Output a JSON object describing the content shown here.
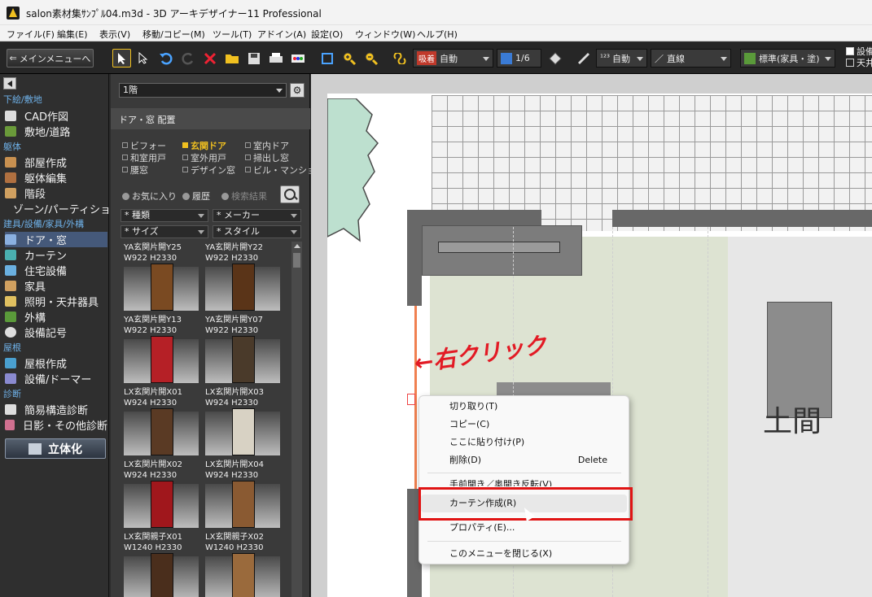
{
  "window": {
    "title": "salon素材集ｻﾝﾌﾟﾙ04.m3d - 3D アーキデザイナー11 Professional"
  },
  "menu": [
    "ファイル(F)",
    "編集(E)",
    "表示(V)",
    "移動/コピー(M)",
    "ツール(T)",
    "アドイン(A)",
    "設定(O)",
    "ウィンドウ(W)",
    "ヘルプ(H)"
  ],
  "toolbar": {
    "main_menu_label": "メインメニューへ",
    "snap_tag": "吸着",
    "snap_mode": "自動",
    "grid_ratio": "1/6",
    "dim_mode": "自動",
    "line_mode": "直線",
    "preset": "標準(家具・塗)",
    "check_1": "設備",
    "check_2": "天井"
  },
  "sidebar": {
    "categories": [
      {
        "label": "下絵/敷地",
        "items": [
          {
            "label": "CAD作図"
          },
          {
            "label": "敷地/道路"
          }
        ]
      },
      {
        "label": "躯体",
        "items": [
          {
            "label": "部屋作成"
          },
          {
            "label": "躯体編集"
          },
          {
            "label": "階段"
          },
          {
            "label": "ゾーン/パーティション"
          }
        ]
      },
      {
        "label": "建具/設備/家具/外構",
        "items": [
          {
            "label": "ドア・窓",
            "active": true
          },
          {
            "label": "カーテン"
          },
          {
            "label": "住宅設備"
          },
          {
            "label": "家具"
          },
          {
            "label": "照明・天井器具"
          },
          {
            "label": "外構"
          },
          {
            "label": "設備記号"
          }
        ]
      },
      {
        "label": "屋根",
        "items": [
          {
            "label": "屋根作成"
          },
          {
            "label": "設備/ドーマー"
          }
        ]
      },
      {
        "label": "診断",
        "items": [
          {
            "label": "簡易構造診断"
          },
          {
            "label": "日影・その他診断"
          }
        ]
      }
    ],
    "render_button": "立体化"
  },
  "panel": {
    "floor": "1階",
    "title": "ドア・窓 配置",
    "categories": [
      "ビフォー",
      "玄関ドア",
      "室内ドア",
      "和室用戸",
      "室外用戸",
      "掃出し窓",
      "腰窓",
      "デザイン窓",
      "ビル・マンション"
    ],
    "selected_category": "玄関ドア",
    "tabs": [
      "お気に入り",
      "履歴",
      "検索結果"
    ],
    "filters": [
      "* 種類",
      "* メーカー",
      "* サイズ",
      "* スタイル"
    ],
    "products": [
      {
        "name": "YA玄関片開Y25",
        "size": "W922 H2330",
        "color": "#7a4a22"
      },
      {
        "name": "YA玄関片開Y22",
        "size": "W922 H2330",
        "color": "#5a3418"
      },
      {
        "name": "YA玄関片開Y13",
        "size": "W922 H2330",
        "color": "#b52026"
      },
      {
        "name": "YA玄関片開Y07",
        "size": "W922 H2330",
        "color": "#4a3a2a"
      },
      {
        "name": "LX玄関片開X01",
        "size": "W924 H2330",
        "color": "#5a3a24"
      },
      {
        "name": "LX玄関片開X03",
        "size": "W924 H2330",
        "color": "#d8d2c4"
      },
      {
        "name": "LX玄関片開X02",
        "size": "W924 H2330",
        "color": "#a0171c"
      },
      {
        "name": "LX玄関片開X04",
        "size": "W924 H2330",
        "color": "#8a5a32"
      },
      {
        "name": "LX玄関親子X01",
        "size": "W1240 H2330",
        "color": "#4a2e1c"
      },
      {
        "name": "LX玄関親子X02",
        "size": "W1240 H2330",
        "color": "#9a6a3c"
      }
    ]
  },
  "canvas": {
    "room_label": "土間",
    "annotation": "←右クリック"
  },
  "context_menu": [
    {
      "label": "切り取り(T)",
      "shortcut": ""
    },
    {
      "label": "コピー(C)",
      "shortcut": ""
    },
    {
      "label": "ここに貼り付け(P)",
      "shortcut": ""
    },
    {
      "label": "削除(D)",
      "shortcut": "Delete"
    },
    {
      "label": "手前開き／奥開き反転(V)",
      "shortcut": ""
    },
    {
      "label": "カーテン作成(R)",
      "shortcut": "",
      "highlighted": true
    },
    {
      "label": "プロパティ(E)...",
      "shortcut": ""
    },
    {
      "label": "このメニューを閉じる(X)",
      "shortcut": ""
    }
  ]
}
